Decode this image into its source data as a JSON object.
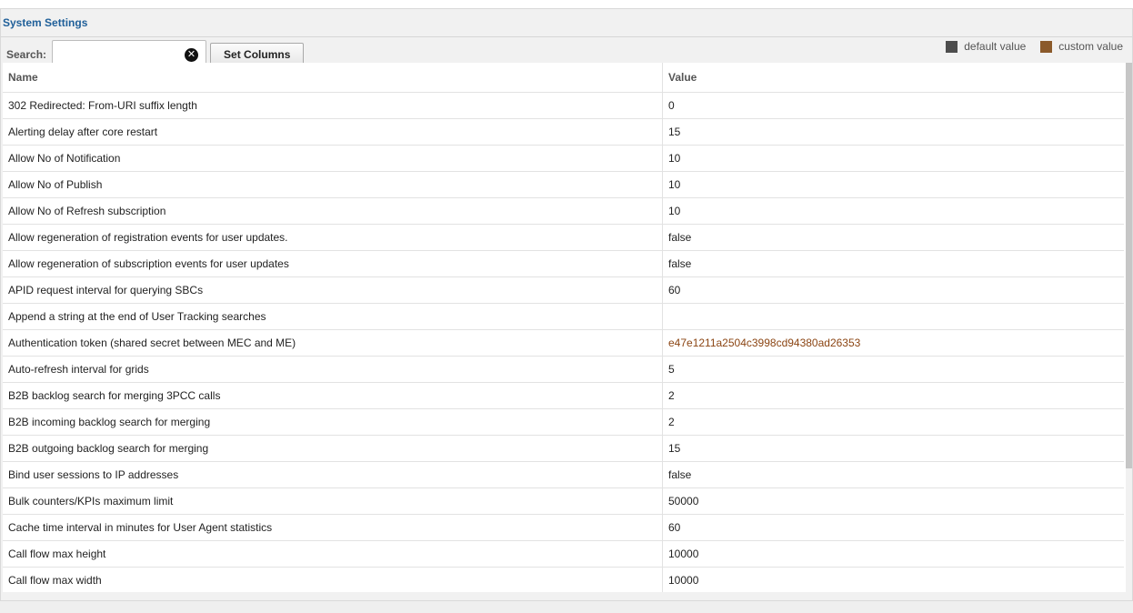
{
  "panel": {
    "title": "System Settings"
  },
  "toolbar": {
    "search_label": "Search:",
    "search_value": "",
    "set_columns_label": "Set Columns"
  },
  "legend": {
    "default_label": "default value",
    "custom_label": "custom value",
    "default_color": "#4d4d4d",
    "custom_color": "#8b5a2b"
  },
  "table": {
    "headers": {
      "name": "Name",
      "value": "Value"
    },
    "rows": [
      {
        "name": "302 Redirected: From-URI suffix length",
        "value": "0",
        "custom": false
      },
      {
        "name": "Alerting delay after core restart",
        "value": "15",
        "custom": false
      },
      {
        "name": "Allow No of Notification",
        "value": "10",
        "custom": false
      },
      {
        "name": "Allow No of Publish",
        "value": "10",
        "custom": false
      },
      {
        "name": "Allow No of Refresh subscription",
        "value": "10",
        "custom": false
      },
      {
        "name": "Allow regeneration of registration events for user updates.",
        "value": "false",
        "custom": false
      },
      {
        "name": "Allow regeneration of subscription events for user updates",
        "value": "false",
        "custom": false
      },
      {
        "name": "APID request interval for querying SBCs",
        "value": "60",
        "custom": false
      },
      {
        "name": "Append a string at the end of User Tracking searches",
        "value": "",
        "custom": false
      },
      {
        "name": "Authentication token (shared secret between MEC and ME)",
        "value": "e47e1211a2504c3998cd94380ad26353",
        "custom": true
      },
      {
        "name": "Auto-refresh interval for grids",
        "value": "5",
        "custom": false
      },
      {
        "name": "B2B backlog search for merging 3PCC calls",
        "value": "2",
        "custom": false
      },
      {
        "name": "B2B incoming backlog search for merging",
        "value": "2",
        "custom": false
      },
      {
        "name": "B2B outgoing backlog search for merging",
        "value": "15",
        "custom": false
      },
      {
        "name": "Bind user sessions to IP addresses",
        "value": "false",
        "custom": false
      },
      {
        "name": "Bulk counters/KPIs maximum limit",
        "value": "50000",
        "custom": false
      },
      {
        "name": "Cache time interval in minutes for User Agent statistics",
        "value": "60",
        "custom": false
      },
      {
        "name": "Call flow max height",
        "value": "10000",
        "custom": false
      },
      {
        "name": "Call flow max width",
        "value": "10000",
        "custom": false
      }
    ]
  }
}
